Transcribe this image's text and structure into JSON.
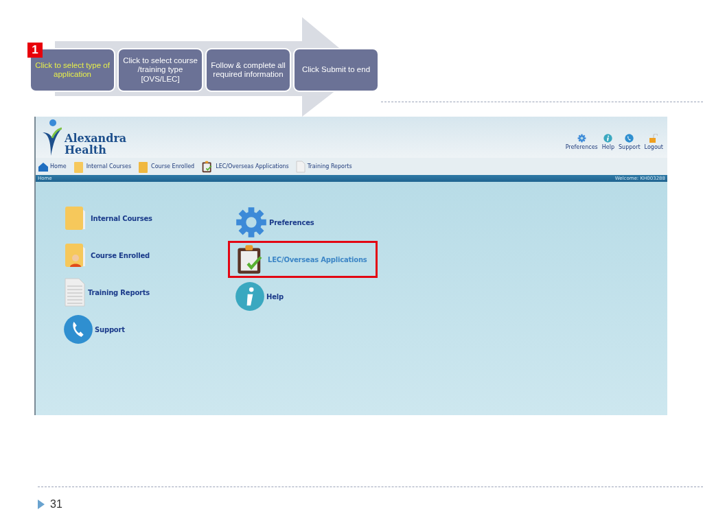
{
  "step_badge": "1",
  "steps": [
    {
      "text": "Click to select type of application",
      "highlighted": true
    },
    {
      "text": "Click to select course /training type [OVS/LEC]",
      "highlighted": false
    },
    {
      "text": "Follow & complete all required information",
      "highlighted": false
    },
    {
      "text": "Click Submit to end",
      "highlighted": false
    }
  ],
  "app": {
    "logo": {
      "line1": "Alexandra",
      "line2": "Health"
    },
    "top_links": [
      {
        "label": "Preferences"
      },
      {
        "label": "Help"
      },
      {
        "label": "Support"
      },
      {
        "label": "Logout"
      }
    ],
    "nav": [
      {
        "label": "Home"
      },
      {
        "label": "Internal Courses"
      },
      {
        "label": "Course Enrolled"
      },
      {
        "label": "LEC/Overseas Applications"
      },
      {
        "label": "Training Reports"
      }
    ],
    "breadcrumb": "Home",
    "welcome": "Welcome: KH003288",
    "tiles_left": [
      {
        "label": "Internal Courses",
        "highlighted": false
      },
      {
        "label": "Course Enrolled",
        "highlighted": false
      },
      {
        "label": "Training Reports",
        "highlighted": false
      },
      {
        "label": "Support",
        "highlighted": false
      }
    ],
    "tiles_right": [
      {
        "label": "Preferences",
        "highlighted": false
      },
      {
        "label": "LEC/Overseas Applications",
        "highlighted": true
      },
      {
        "label": "Help",
        "highlighted": false
      }
    ]
  },
  "slide_number": "31"
}
